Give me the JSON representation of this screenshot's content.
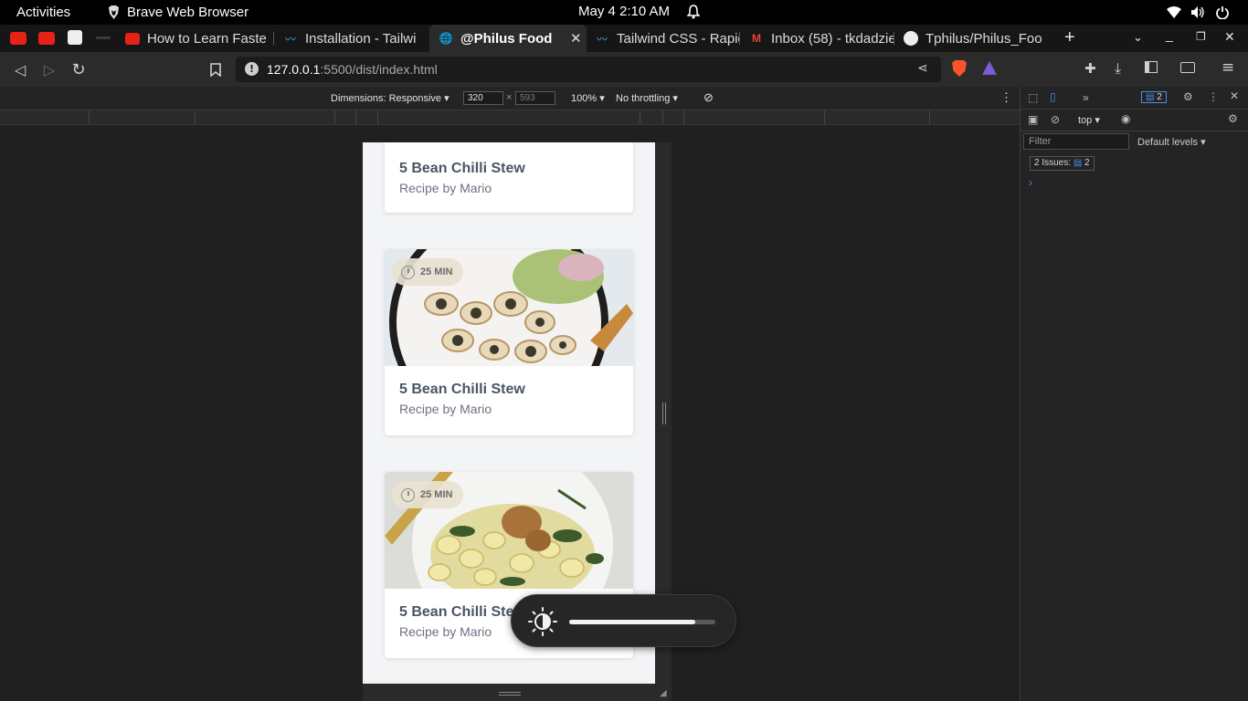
{
  "topbar": {
    "activities": "Activities",
    "app_name": "Brave Web Browser",
    "clock": "May 4   2:10 AM"
  },
  "tabs": [
    {
      "title": "How to Learn Faste",
      "favicon": "youtube-icon"
    },
    {
      "title": "Installation - Tailwi",
      "favicon": "tailwind-icon"
    },
    {
      "title": "@Philus Food",
      "favicon": "globe-icon",
      "active": true
    },
    {
      "title": "Tailwind CSS - Rapid",
      "favicon": "tailwind-icon"
    },
    {
      "title": "Inbox (58) - tkdadzie",
      "favicon": "gmail-icon"
    },
    {
      "title": "Tphilus/Philus_Foo",
      "favicon": "github-icon"
    }
  ],
  "address": {
    "host": "127.0.0.1",
    "path": ":5500/dist/index.html"
  },
  "devtools_toolbar": {
    "dimensions_label": "Dimensions: Responsive",
    "width": "320",
    "height": "593",
    "zoom": "100%",
    "throttling": "No throttling"
  },
  "devpanel": {
    "context": "top",
    "filter_placeholder": "Filter",
    "levels": "Default levels",
    "issues_label": "2 Issues:",
    "issues_count": "2",
    "issues_badge": "2"
  },
  "recipes": [
    {
      "title": "5 Bean Chilli Stew",
      "author": "Recipe by Mario",
      "time": "25 MIN"
    },
    {
      "title": "5 Bean Chilli Stew",
      "author": "Recipe by Mario",
      "time": "25 MIN"
    },
    {
      "title": "5 Bean Chilli Stew",
      "author": "Recipe by Mario",
      "time": "25 MIN"
    }
  ],
  "osd": {
    "icon": "brightness-icon",
    "level": 0.86
  },
  "colors": {
    "page_bg": "#f3f4f6",
    "title": "#4b5563",
    "subtitle": "#6b7280",
    "link_blue": "#4a8df0"
  }
}
